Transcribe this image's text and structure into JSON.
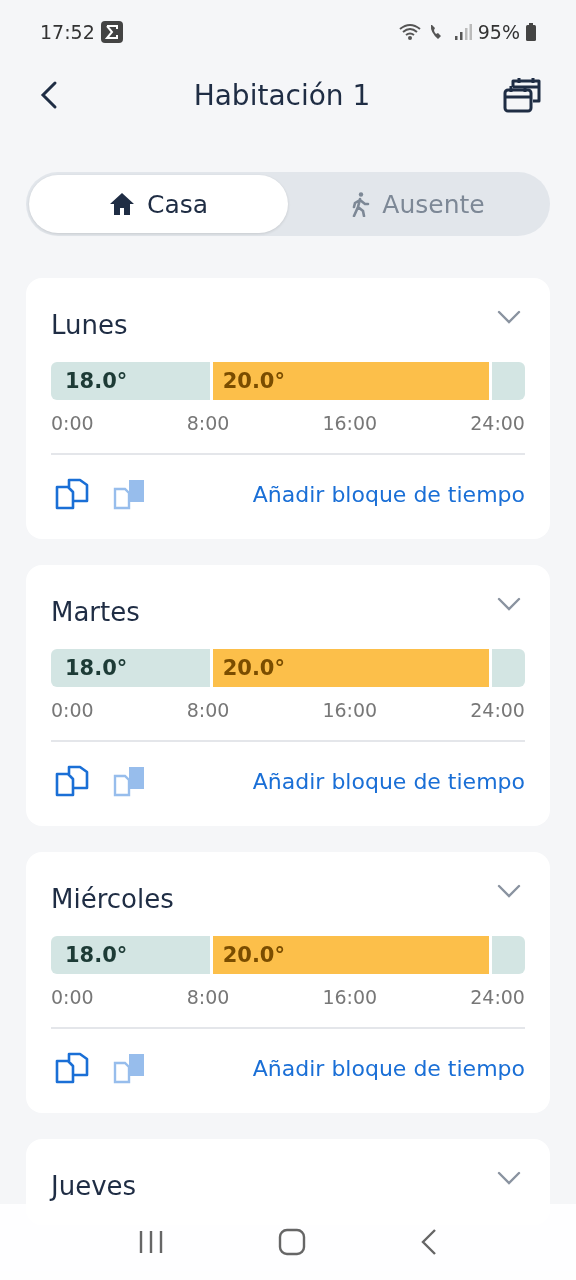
{
  "status_bar": {
    "time": "17:52",
    "battery": "95%"
  },
  "header": {
    "title": "Habitación 1"
  },
  "tabs": [
    {
      "label": "Casa",
      "kind": "home",
      "selected": true
    },
    {
      "label": "Ausente",
      "kind": "away",
      "selected": false
    }
  ],
  "days": [
    {
      "name": "Lunes",
      "expanded": false,
      "blocks": [
        {
          "label": "18.0°",
          "color": "#d3e5e3"
        },
        {
          "label": "20.0°",
          "color": "#fcbf4a"
        },
        {
          "color": "#d3e5e3"
        }
      ],
      "ticks": [
        "0:00",
        "8:00",
        "16:00",
        "24:00"
      ],
      "paste_enabled": false,
      "action": "Añadir bloque de tiempo"
    },
    {
      "name": "Martes",
      "expanded": false,
      "blocks": [
        {
          "label": "18.0°",
          "color": "#d3e5e3"
        },
        {
          "label": "20.0°",
          "color": "#fcbf4a"
        },
        {
          "color": "#d3e5e3"
        }
      ],
      "ticks": [
        "0:00",
        "8:00",
        "16:00",
        "24:00"
      ],
      "paste_enabled": false,
      "action": "Añadir bloque de tiempo"
    },
    {
      "name": "Miércoles",
      "expanded": false,
      "blocks": [
        {
          "label": "18.0°",
          "color": "#d3e5e3"
        },
        {
          "label": "20.0°",
          "color": "#fcbf4a"
        },
        {
          "color": "#d3e5e3"
        }
      ],
      "ticks": [
        "0:00",
        "8:00",
        "16:00",
        "24:00"
      ],
      "paste_enabled": false,
      "action": "Añadir bloque de tiempo"
    },
    {
      "name": "Jueves",
      "expanded": false
    }
  ]
}
